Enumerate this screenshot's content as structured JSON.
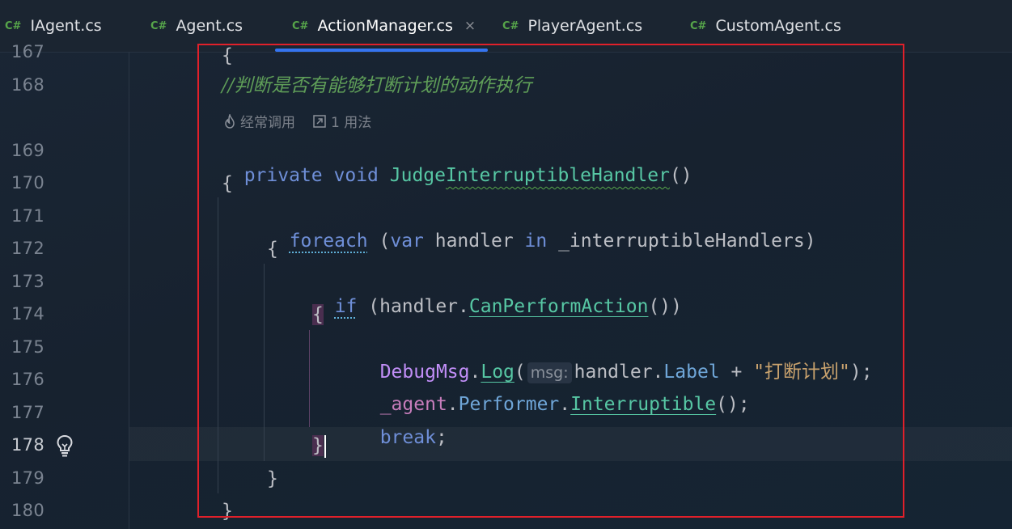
{
  "tabs": [
    {
      "lang": "C#",
      "label": "IAgent.cs"
    },
    {
      "lang": "C#",
      "label": "Agent.cs"
    },
    {
      "lang": "C#",
      "label": "ActionManager.cs",
      "close": "×"
    },
    {
      "lang": "C#",
      "label": "PlayerAgent.cs"
    },
    {
      "lang": "C#",
      "label": "CustomAgent.cs"
    }
  ],
  "active_tab": "ActionManager.cs",
  "line_numbers": [
    "167",
    "168",
    "169",
    "170",
    "171",
    "172",
    "173",
    "174",
    "175",
    "176",
    "177",
    "178",
    "179",
    "180"
  ],
  "current_line": "178",
  "code": {
    "l167": "{",
    "l168_comment": "//判断是否有能够打断计划的动作执行",
    "codelens": {
      "usage_freq": "经常调用",
      "usages": "1 用法"
    },
    "l169": {
      "kw1": "private",
      "kw2": "void",
      "fn_a": "Judge",
      "fn_b": "InterruptibleHandler",
      "rest": "()"
    },
    "l170": "{",
    "l171": {
      "kw1": "foreach",
      "p1": " (",
      "kw2": "var",
      "p2": " handler ",
      "kw3": "in",
      "p3": " _interruptibleHandlers)"
    },
    "l172": "{",
    "l173": {
      "kw": "if",
      "p1": " (handler.",
      "fn": "CanPerformAction",
      "p2": "())"
    },
    "l174": "{",
    "l175": {
      "cls": "DebugMsg",
      "dot": ".",
      "fn": "Log",
      "p1": "(",
      "hint": "msg:",
      "p2": "handler.",
      "field": "Label",
      "p3": " + ",
      "str": "\"打断计划\"",
      "p4": ");"
    },
    "l176": {
      "field1": "_agent",
      "dot1": ".",
      "field2": "Performer",
      "dot2": ".",
      "fn": "Interruptible",
      "p": "();"
    },
    "l177": {
      "kw": "break",
      "p": ";"
    },
    "l178": "}",
    "l179": "}",
    "l180": "}"
  },
  "colors": {
    "accent": "#3574f0",
    "highlight_box": "#e0202a",
    "keyword": "#6f8fd8",
    "method": "#57c7a4",
    "string": "#c9a26d",
    "comment": "#5f9e58"
  },
  "icons": [
    "csharp-file-icon",
    "close-icon",
    "flame-icon",
    "usages-link-icon",
    "lightbulb-icon"
  ]
}
